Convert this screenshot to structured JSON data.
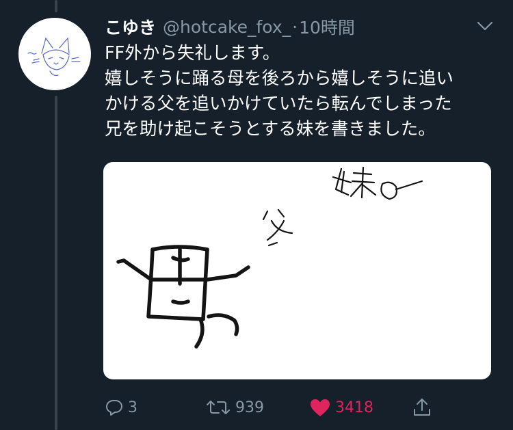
{
  "tweet": {
    "display_name": "こゆき",
    "handle": "@hotcake_fox_",
    "separator": "·",
    "time": "10時間",
    "lines": [
      "FF外から失礼します。",
      "嬉しそうに踊る母を後ろから嬉しそうに追い",
      "かける父を追いかけていたら転んでしまった",
      "兄を助け起こそうとする妹を書きました。"
    ]
  },
  "media": {
    "drawn_characters": [
      "妹",
      "父",
      "母"
    ]
  },
  "actions": {
    "reply_count": "3",
    "retweet_count": "939",
    "like_count": "3418"
  },
  "colors": {
    "background": "#15202b",
    "secondary_text": "#8899a6",
    "like": "#e0245e",
    "thread_line": "#38444d"
  },
  "icons": {
    "reply": "reply-icon",
    "retweet": "retweet-icon",
    "like": "heart-icon",
    "share": "share-icon",
    "menu": "chevron-down-icon"
  }
}
